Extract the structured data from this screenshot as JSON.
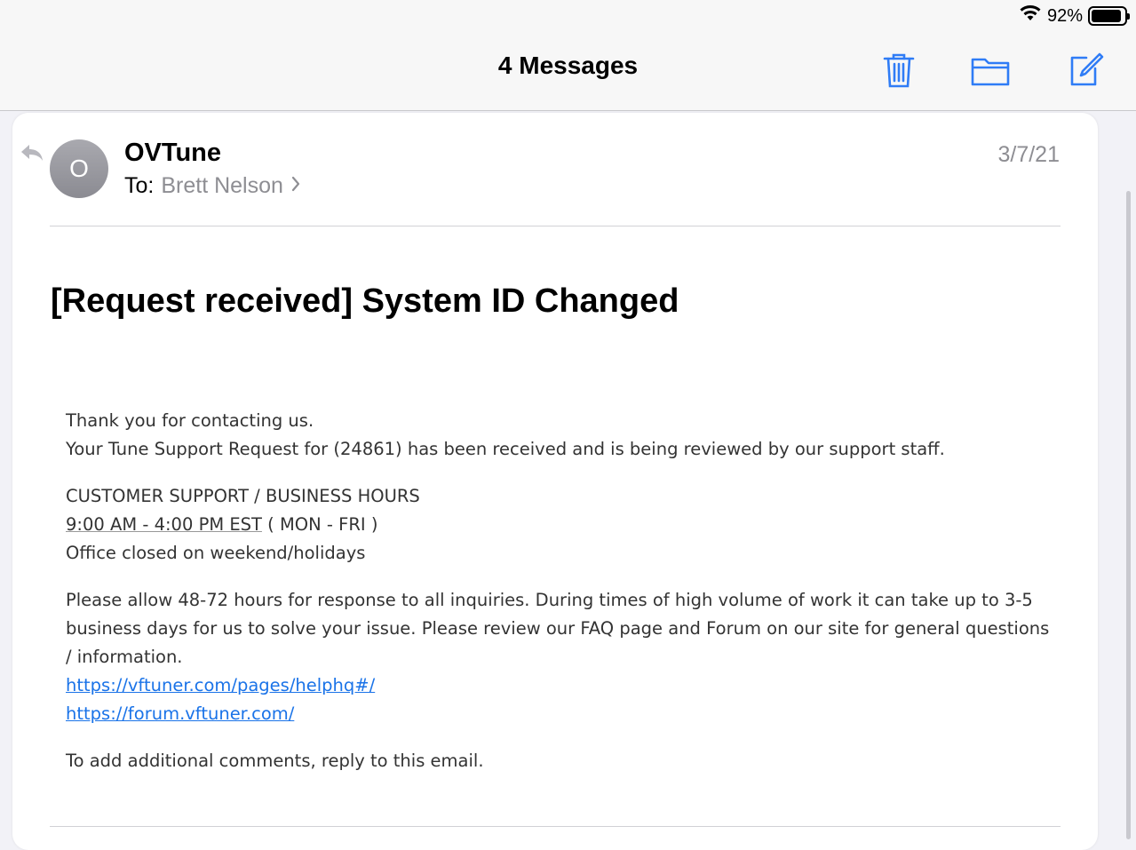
{
  "status": {
    "battery": "92%",
    "battery_level": 0.92
  },
  "nav": {
    "title": "4 Messages",
    "icons": [
      "trash-icon",
      "folder-icon",
      "compose-icon"
    ]
  },
  "message": {
    "avatar_initial": "O",
    "sender": "OVTune",
    "to_label": "To:",
    "to_name": "Brett Nelson",
    "date": "3/7/21",
    "subject": "[Request received] System ID Changed",
    "body": {
      "p1_line1": "Thank you for contacting us.",
      "p1_line2": "Your Tune Support Request for (24861) has been received and is being reviewed by our support staff.",
      "p2_line1": "CUSTOMER SUPPORT / BUSINESS HOURS",
      "p2_hours": "9:00 AM - 4:00 PM EST",
      "p2_days": " ( MON - FRI )",
      "p2_line3": "Office closed on weekend/holidays",
      "p3_text": "Please allow 48-72 hours for response to all inquiries. During times of high volume of work it can take up to 3-5 business days for us to solve your issue. Please review our FAQ page and Forum on our site for general questions / information.",
      "link1": "https://vftuner.com/pages/helphq#/",
      "link2": "https://forum.vftuner.com/",
      "p4": "To add additional comments, reply to this email."
    }
  },
  "colors": {
    "accent": "#1a73e8",
    "icon_blue": "#2f7cf6",
    "secondary_text": "#8e8e93"
  }
}
